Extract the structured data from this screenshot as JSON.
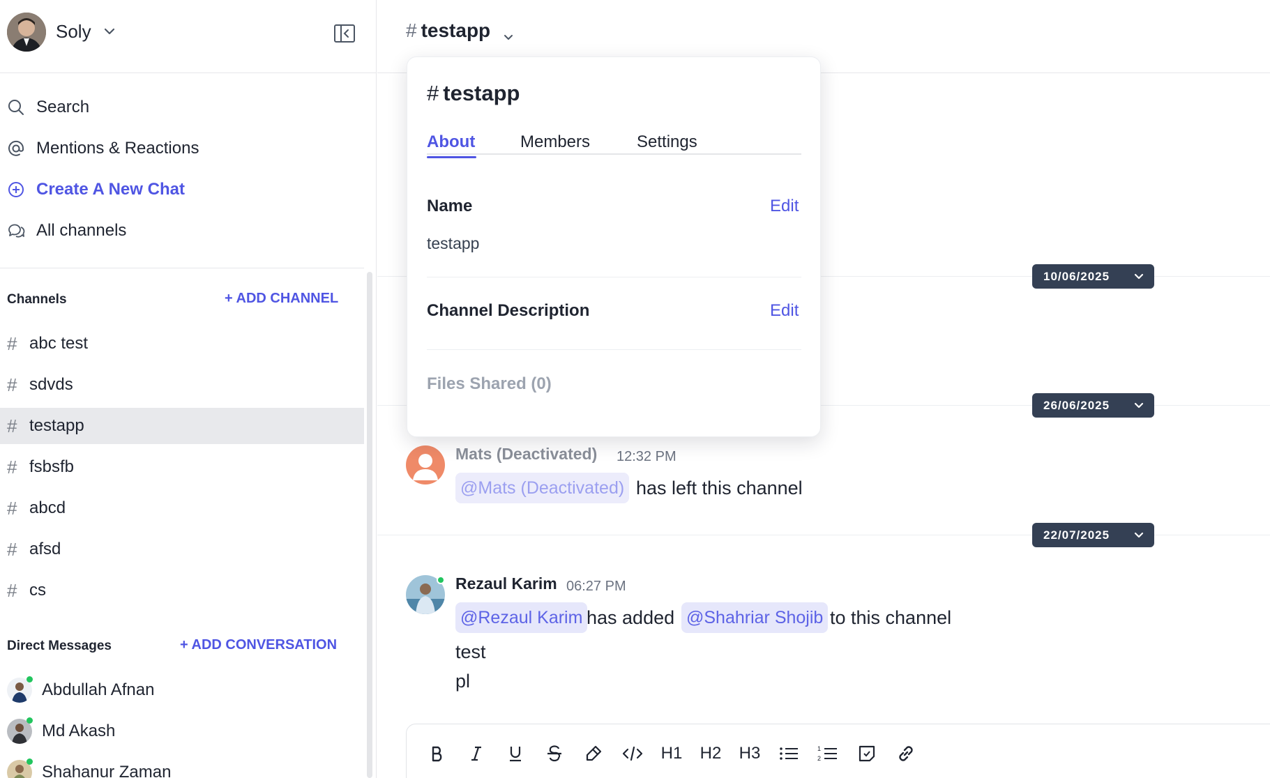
{
  "user": {
    "name": "Soly"
  },
  "nav": {
    "search": "Search",
    "mentions": "Mentions & Reactions",
    "create_chat": "Create A New Chat",
    "all_channels": "All channels"
  },
  "channels": {
    "heading": "Channels",
    "add_label": "+ ADD CHANNEL",
    "items": [
      "abc test",
      "sdvds",
      "testapp",
      "fsbsfb",
      "abcd",
      "afsd",
      "cs"
    ],
    "active": "testapp"
  },
  "direct_messages": {
    "heading": "Direct Messages",
    "add_label": "+ ADD CONVERSATION",
    "items": [
      "Abdullah Afnan",
      "Md Akash",
      "Shahanur Zaman"
    ]
  },
  "header": {
    "hash": "#",
    "channel_name": "testapp"
  },
  "popover": {
    "hash": "#",
    "title": "testapp",
    "tabs": [
      "About",
      "Members",
      "Settings"
    ],
    "active_tab": "About",
    "name_label": "Name",
    "name_edit": "Edit",
    "name_value": "testapp",
    "desc_label": "Channel Description",
    "desc_edit": "Edit",
    "files_label": "Files Shared (0)"
  },
  "dates": [
    "10/06/2025",
    "26/06/2025",
    "22/07/2025"
  ],
  "messages": [
    {
      "author": "Mats (Deactivated)",
      "time": "12:32 PM",
      "mention": "@Mats (Deactivated)",
      "text": "has left this channel"
    },
    {
      "author": "Rezaul Karim",
      "time": "06:27 PM",
      "mention_1": "@Rezaul Karim",
      "text_1": "has added",
      "mention_2": "@Shahriar Shojib",
      "text_2": "to this channel",
      "line_2": "test",
      "line_3": "pl"
    }
  ],
  "toolbar": {
    "h1": "H1",
    "h2": "H2",
    "h3": "H3"
  },
  "colors": {
    "accent": "#4f55e3",
    "date_pill": "#344054",
    "online": "#22c55e",
    "mention_bg": "#e6e7fb",
    "active_row": "#e8e9ec"
  }
}
